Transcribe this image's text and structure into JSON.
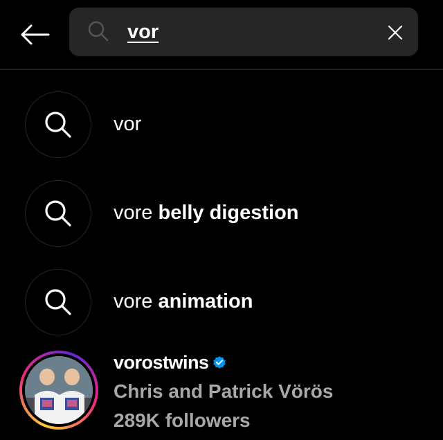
{
  "search": {
    "query": "vor",
    "typed": "vor"
  },
  "suggestions": [
    {
      "typed": "vor",
      "rest": ""
    },
    {
      "typed": "vore",
      "rest": " belly digestion"
    },
    {
      "typed": "vore",
      "rest": " animation"
    }
  ],
  "account": {
    "username": "vorostwins",
    "verified": true,
    "full_name": "Chris and Patrick Vörös",
    "followers": "289K followers"
  },
  "icons": {
    "back": "arrow-left-icon",
    "search": "search-icon",
    "clear": "close-icon",
    "verified": "verified-badge-icon"
  },
  "colors": {
    "background": "#000000",
    "search_field": "#262626",
    "secondary_text": "#a8a8a8",
    "verified_blue": "#0095f6"
  }
}
